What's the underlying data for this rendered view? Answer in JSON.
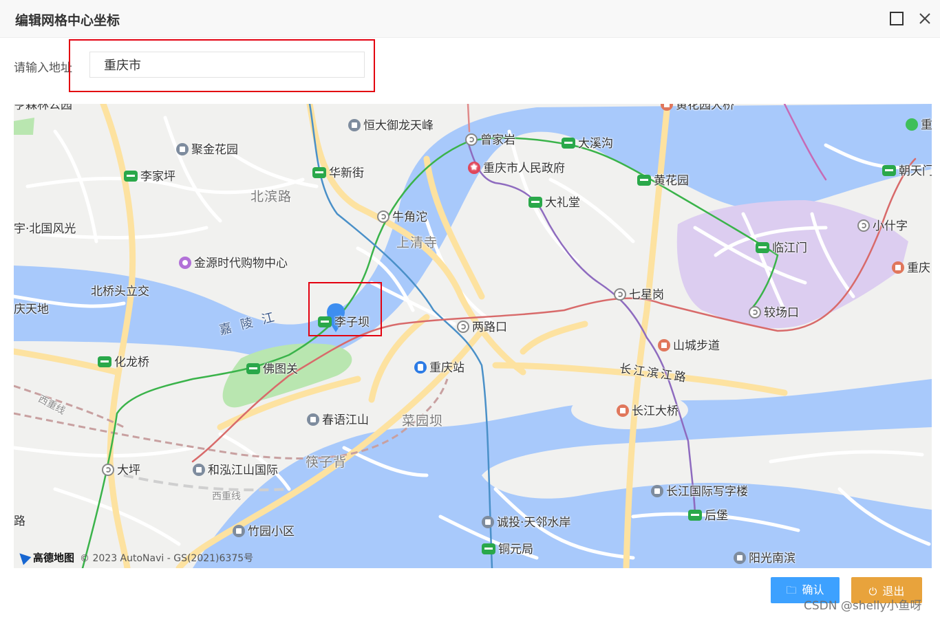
{
  "dialog": {
    "title": "编辑网格中心坐标"
  },
  "form": {
    "address_label": "请输入地址",
    "address_value": "重庆市"
  },
  "map": {
    "attribution_logo": "高德地图",
    "attribution_text": "© 2023 AutoNavi - GS(2021)6375号",
    "labels": [
      {
        "id": "pl-1",
        "text": "恒大御龙天峰",
        "icon": "poi"
      },
      {
        "id": "pl-2",
        "text": "曾家岩",
        "icon": "transfer"
      },
      {
        "id": "pl-3",
        "text": "大溪沟",
        "icon": "metro"
      },
      {
        "id": "pl-4",
        "text": "黄花园大桥",
        "icon": "scenic"
      },
      {
        "id": "pl-5",
        "text": "聚金花园",
        "icon": "poi"
      },
      {
        "id": "pl-6",
        "text": "华新街",
        "icon": "metro"
      },
      {
        "id": "pl-7",
        "text": "重庆市人民政府",
        "icon": "gov"
      },
      {
        "id": "pl-8",
        "text": "黄花园",
        "icon": "metro"
      },
      {
        "id": "pl-9",
        "text": "朝天门",
        "icon": "metro"
      },
      {
        "id": "pl-10",
        "text": "李家坪",
        "icon": "metro"
      },
      {
        "id": "pl-11",
        "text": "大礼堂",
        "icon": "metro"
      },
      {
        "id": "pl-12",
        "text": "北滨路",
        "icon": "none"
      },
      {
        "id": "pl-13",
        "text": "牛角沱",
        "icon": "transfer"
      },
      {
        "id": "pl-14",
        "text": "小什字",
        "icon": "transfer"
      },
      {
        "id": "pl-15",
        "text": "宇·北国风光",
        "icon": "none"
      },
      {
        "id": "pl-16",
        "text": "上清寺",
        "icon": "none"
      },
      {
        "id": "pl-17",
        "text": "临江门",
        "icon": "metro"
      },
      {
        "id": "pl-18",
        "text": "金源时代购物中心",
        "icon": "shop"
      },
      {
        "id": "pl-19",
        "text": "重庆",
        "icon": "scenic"
      },
      {
        "id": "pl-20",
        "text": "北桥头立交",
        "icon": "none"
      },
      {
        "id": "pl-21",
        "text": "七星岗",
        "icon": "transfer"
      },
      {
        "id": "pl-22",
        "text": "庆天地",
        "icon": "none"
      },
      {
        "id": "pl-23",
        "text": "嘉 陵 江",
        "icon": "none"
      },
      {
        "id": "pl-24",
        "text": "李子坝",
        "icon": "metro"
      },
      {
        "id": "pl-25",
        "text": "两路口",
        "icon": "transfer"
      },
      {
        "id": "pl-26",
        "text": "较场口",
        "icon": "transfer"
      },
      {
        "id": "pl-27",
        "text": "山城步道",
        "icon": "scenic"
      },
      {
        "id": "pl-28",
        "text": "化龙桥",
        "icon": "metro"
      },
      {
        "id": "pl-29",
        "text": "佛图关",
        "icon": "metro"
      },
      {
        "id": "pl-30",
        "text": "重庆站",
        "icon": "train"
      },
      {
        "id": "pl-31",
        "text": "长江滨江路",
        "icon": "none"
      },
      {
        "id": "pl-32",
        "text": "西重线",
        "icon": "none"
      },
      {
        "id": "pl-33",
        "text": "长江大桥",
        "icon": "scenic"
      },
      {
        "id": "pl-34",
        "text": "春语江山",
        "icon": "poi"
      },
      {
        "id": "pl-35",
        "text": "菜园坝",
        "icon": "none"
      },
      {
        "id": "pl-36",
        "text": "大坪",
        "icon": "transfer"
      },
      {
        "id": "pl-37",
        "text": "和泓江山国际",
        "icon": "poi"
      },
      {
        "id": "pl-38",
        "text": "筷子背",
        "icon": "none"
      },
      {
        "id": "pl-39",
        "text": "长江国际写字楼",
        "icon": "poi"
      },
      {
        "id": "pl-40",
        "text": "西重线",
        "icon": "none"
      },
      {
        "id": "pl-41",
        "text": "后堡",
        "icon": "metro"
      },
      {
        "id": "pl-42",
        "text": "路",
        "icon": "none"
      },
      {
        "id": "pl-43",
        "text": "诚投·天邻水岸",
        "icon": "poi"
      },
      {
        "id": "pl-44",
        "text": "竹园小区",
        "icon": "poi"
      },
      {
        "id": "pl-45",
        "text": "铜元局",
        "icon": "metro"
      },
      {
        "id": "pl-46",
        "text": "阳光南滨",
        "icon": "poi"
      },
      {
        "id": "pl-47",
        "text": "亨森林公园",
        "icon": "none"
      },
      {
        "id": "pl-48",
        "text": "重",
        "icon": "park"
      }
    ]
  },
  "buttons": {
    "confirm": "确认",
    "exit": "退出"
  },
  "watermark": "CSDN @shelly小鱼呀",
  "colors": {
    "selection_box": "#e3000f",
    "confirm": "#3da1ff",
    "exit": "#e8a33c",
    "water": "#a8c9fb",
    "metro_green": "#2aa84a"
  }
}
